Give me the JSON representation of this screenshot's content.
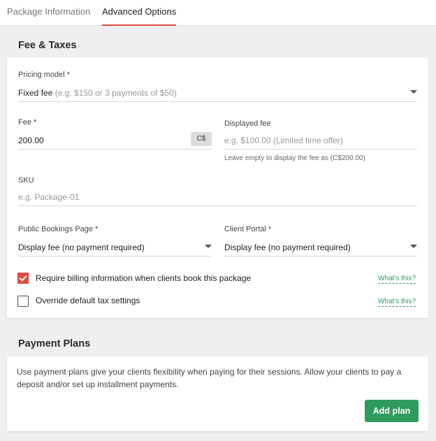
{
  "tabs": [
    {
      "label": "Package Information",
      "active": false
    },
    {
      "label": "Advanced Options",
      "active": true
    }
  ],
  "fees_section": {
    "title": "Fee & Taxes",
    "pricing_model": {
      "label": "Pricing model *",
      "value": "Fixed fee",
      "hint_inline": "(e.g. $150 or 3 payments of $50)"
    },
    "fee": {
      "label": "Fee *",
      "value": "200.00",
      "currency": "C$"
    },
    "displayed_fee": {
      "label": "Displayed fee",
      "placeholder": "e.g. $100.00 (Limited time offer)",
      "help": "Leave empty to display the fee as (C$200.00)"
    },
    "sku": {
      "label": "SKU",
      "placeholder": "e.g. Package-01"
    },
    "public_bookings": {
      "label": "Public Bookings Page *",
      "value": "Display fee (no payment required)"
    },
    "client_portal": {
      "label": "Client Portal *",
      "value": "Display fee (no payment required)"
    },
    "require_billing": {
      "label": "Require billing information when clients book this package",
      "checked": true,
      "help_link": "What's this?"
    },
    "override_tax": {
      "label": "Override default tax settings",
      "checked": false,
      "help_link": "What's this?"
    }
  },
  "payment_plans": {
    "title": "Payment Plans",
    "description": "Use payment plans give your clients flexibility when paying for their sessions. Allow your clients to pay a deposit and/or set up installment payments.",
    "add_button": "Add plan"
  },
  "colors": {
    "accent": "#e04a3f",
    "primary_button": "#2e9b5c",
    "link": "#2e9b5c"
  }
}
